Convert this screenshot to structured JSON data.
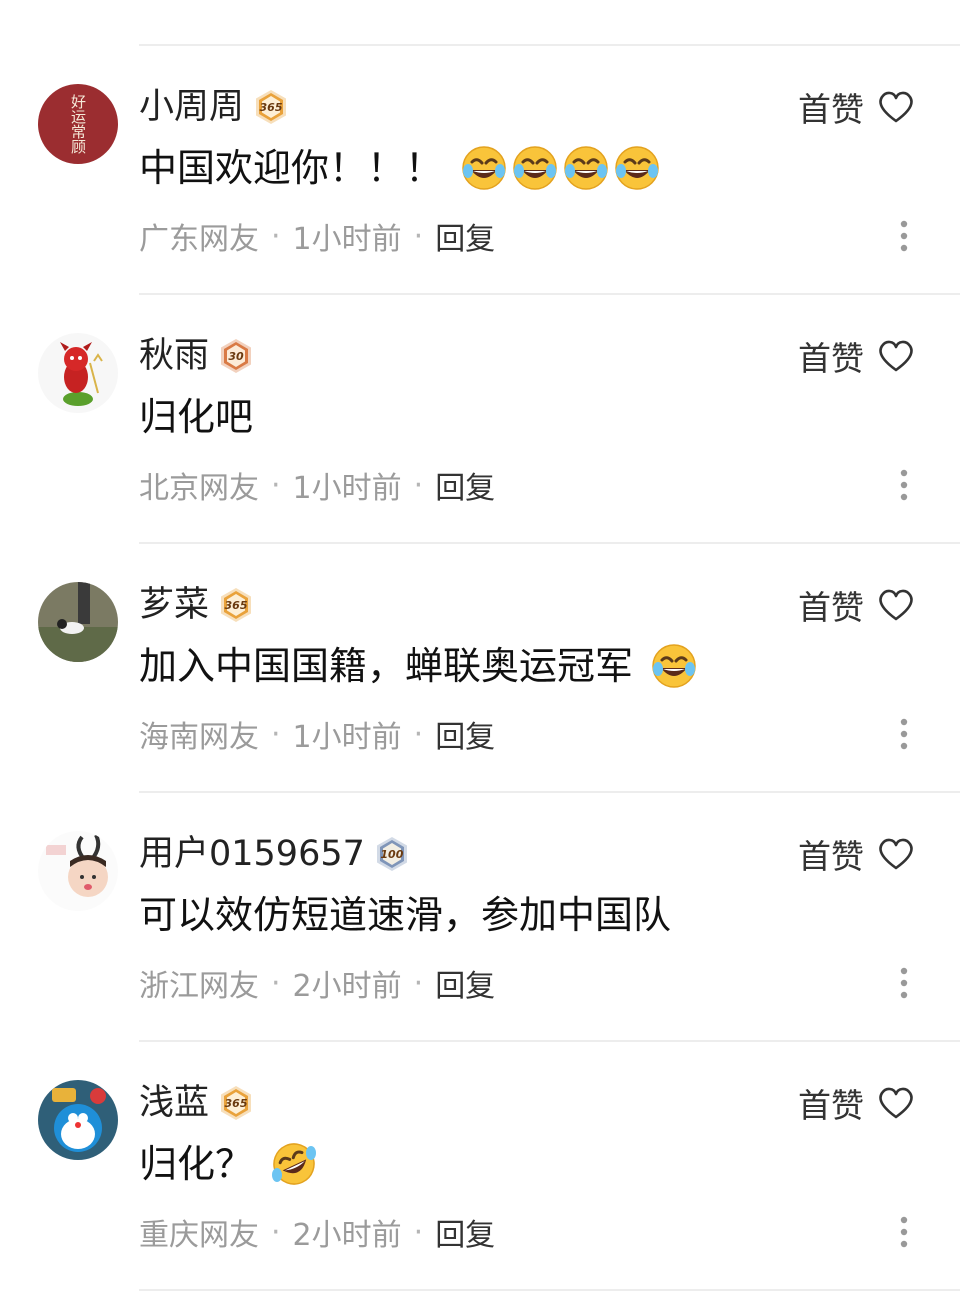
{
  "like_label": "首赞",
  "reply_label": "回复",
  "separator": "·",
  "comments": [
    {
      "username": "小周周",
      "badge": {
        "value": "365",
        "color": "#e9a23b"
      },
      "text": "中国欢迎你！！！",
      "emojis": [
        "laughing-tears",
        "laughing-tears",
        "laughing-tears",
        "laughing-tears"
      ],
      "location": "广东网友",
      "time": "1小时前",
      "avatar_icon": "calligraphy-seal-avatar",
      "avatar_text": "好运常顾"
    },
    {
      "username": "秋雨",
      "badge": {
        "value": "30",
        "color": "#d97a45"
      },
      "text": "归化吧",
      "emojis": [],
      "location": "北京网友",
      "time": "1小时前",
      "avatar_icon": "red-devil-avatar"
    },
    {
      "username": "芗菜",
      "badge": {
        "value": "365",
        "color": "#e9a23b"
      },
      "text": "加入中国国籍，蝉联奥运冠军",
      "emojis": [
        "laughing-tears"
      ],
      "location": "海南网友",
      "time": "1小时前",
      "avatar_icon": "cat-on-grass-avatar"
    },
    {
      "username": "用户0159657",
      "badge": {
        "value": "100",
        "color": "#7f95b8"
      },
      "text": "可以效仿短道速滑，参加中国队",
      "emojis": [],
      "location": "浙江网友",
      "time": "2小时前",
      "avatar_icon": "baby-bunny-ears-avatar"
    },
    {
      "username": "浅蓝",
      "badge": {
        "value": "365",
        "color": "#e9a23b"
      },
      "text": "归化？",
      "emojis": [
        "rolling-laughing"
      ],
      "location": "重庆网友",
      "time": "2小时前",
      "avatar_icon": "doraemon-toy-avatar"
    }
  ]
}
